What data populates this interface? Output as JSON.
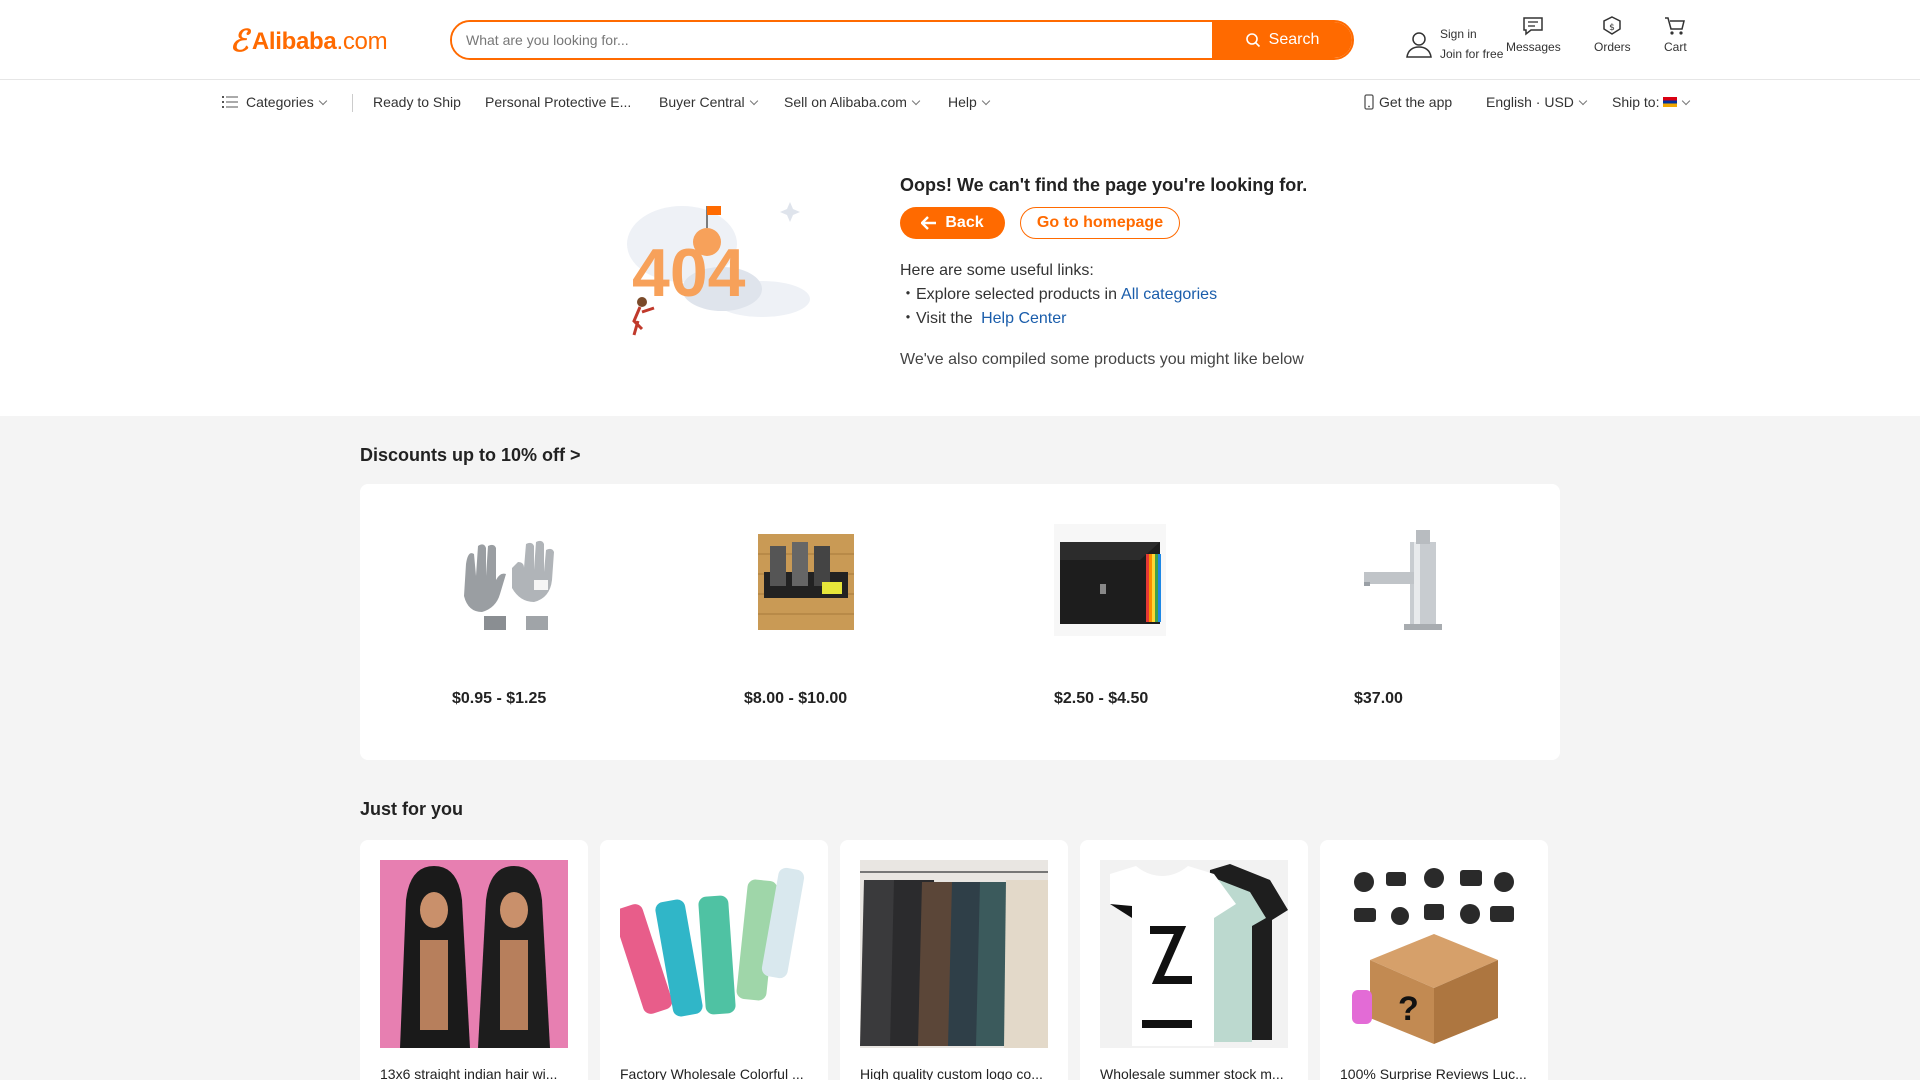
{
  "header": {
    "logo_text": "Alibaba",
    "logo_suffix": ".com",
    "search_placeholder": "What are you looking for...",
    "search_label": "Search",
    "signin_label": "Sign in",
    "join_label": "Join for free",
    "messages_label": "Messages",
    "orders_label": "Orders",
    "cart_label": "Cart",
    "accent": "#ff6a00"
  },
  "nav": {
    "categories": "Categories",
    "items": [
      "Ready to Ship",
      "Personal Protective E...",
      "Buyer Central",
      "Sell on Alibaba.com",
      "Help"
    ],
    "get_app": "Get the app",
    "language": "English · USD",
    "ship_to": "Ship to:"
  },
  "error": {
    "illustration_text": "404",
    "title": "Oops! We can't find the page you're looking for.",
    "back_label": "Back",
    "home_label": "Go to homepage",
    "links_intro": "Here are some useful links:",
    "explore_text": "・Explore selected products in",
    "explore_link": "All categories",
    "visit_text": "・Visit the",
    "visit_link": "Help Center",
    "compiled": "We've also compiled some products you might like below"
  },
  "discounts": {
    "title": "Discounts up to 10%  off >",
    "items": [
      {
        "price": "$0.95 - $1.25",
        "icon": "gloves-image"
      },
      {
        "price": "$8.00 - $10.00",
        "icon": "tool-holder-image"
      },
      {
        "price": "$2.50 - $4.50",
        "icon": "expanding-file-folder-image"
      },
      {
        "price": "$37.00",
        "icon": "faucet-image"
      }
    ]
  },
  "just_for_you": {
    "title": "Just for you",
    "items": [
      {
        "title": "13x6 straight indian hair wi...",
        "icon": "hair-wig-image"
      },
      {
        "title": "Factory Wholesale Colorful ...",
        "icon": "water-bottles-image"
      },
      {
        "title": "High quality custom logo co...",
        "icon": "hoodies-image"
      },
      {
        "title": "Wholesale summer stock m...",
        "icon": "tshirts-image"
      },
      {
        "title": "100% Surprise Reviews Luc...",
        "icon": "mystery-box-image"
      }
    ]
  }
}
